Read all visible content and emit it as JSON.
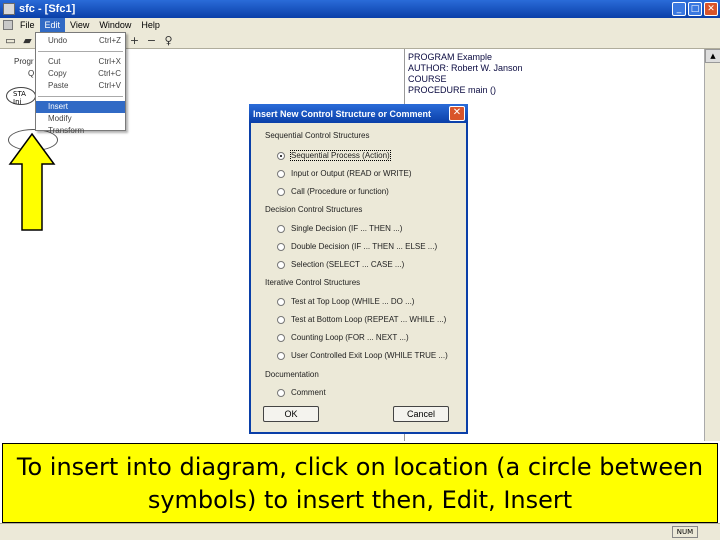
{
  "window": {
    "title": "sfc - [Sfc1]"
  },
  "menubar": {
    "items": [
      "File",
      "Edit",
      "View",
      "Window",
      "Help"
    ]
  },
  "toolbar": {
    "icons": [
      "new-icon",
      "open-icon",
      "plus-icon",
      "minus-icon",
      "cursor-icon"
    ]
  },
  "edit_menu": {
    "items": [
      {
        "label": "Undo",
        "shortcut": "Ctrl+Z"
      },
      {
        "label": "Cut",
        "shortcut": "Ctrl+X"
      },
      {
        "label": "Copy",
        "shortcut": "Ctrl+C"
      },
      {
        "label": "Paste",
        "shortcut": "Ctrl+V"
      },
      {
        "label": "Insert",
        "shortcut": ""
      },
      {
        "label": "Modify",
        "shortcut": ""
      },
      {
        "label": "Transform",
        "shortcut": ""
      }
    ]
  },
  "diagram": {
    "label1": "Progr",
    "label2": "Q",
    "start": "STA",
    "start_sub": "Ini"
  },
  "code_panel": {
    "lines": [
      "PROGRAM Example",
      "AUTHOR: Robert W. Janson",
      "COURSE",
      "",
      "PROCEDURE main ()"
    ]
  },
  "dialog": {
    "title": "Insert New Control Structure or Comment",
    "groups": [
      {
        "label": "Sequential Control Structures",
        "options": [
          "Sequential Process (Action)",
          "Input or Output (READ or WRITE)",
          "Call (Procedure or function)"
        ]
      },
      {
        "label": "Decision Control Structures",
        "options": [
          "Single Decision (IF ... THEN ...)",
          "Double Decision (IF ... THEN ... ELSE ...)",
          "Selection (SELECT ... CASE ...)"
        ]
      },
      {
        "label": "Iterative Control Structures",
        "options": [
          "Test at Top Loop (WHILE ... DO ...)",
          "Test at Bottom Loop (REPEAT ... WHILE ...)",
          "Counting Loop (FOR ... NEXT ...)",
          "User Controlled Exit Loop (WHILE TRUE ...)"
        ]
      },
      {
        "label": "Documentation",
        "options": [
          "Comment"
        ]
      }
    ],
    "selected": "Sequential Process (Action)",
    "ok_label": "OK",
    "cancel_label": "Cancel"
  },
  "caption": "To insert into diagram, click on location (a circle between symbols) to insert then, Edit, Insert",
  "status": {
    "pane": "NUM"
  },
  "colors": {
    "titlebar": "#0a3fa8",
    "highlight": "#316ac5",
    "caption_bg": "#ffff00",
    "arrow_fill": "#ffff00"
  }
}
